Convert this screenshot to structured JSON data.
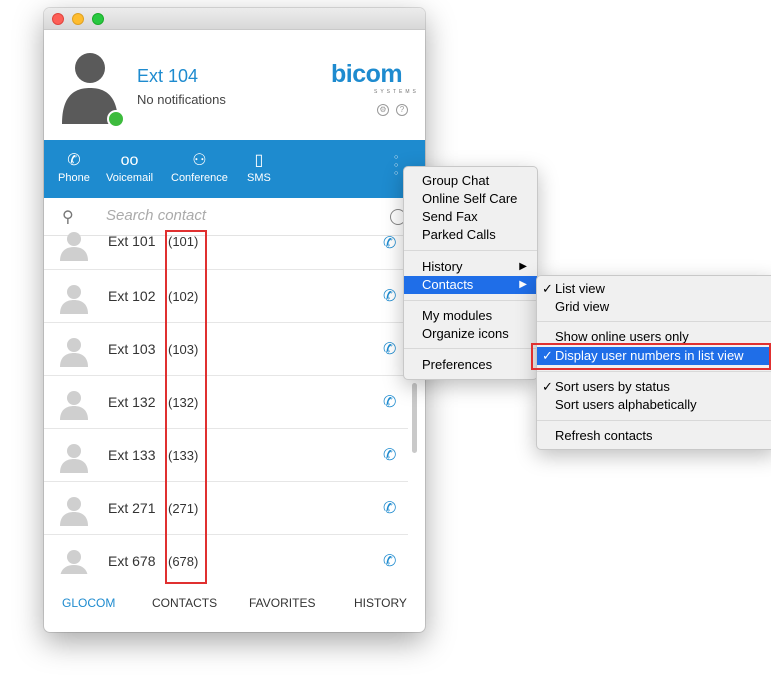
{
  "window": {
    "title": ""
  },
  "profile": {
    "name": "Ext 104",
    "status_text": "No notifications"
  },
  "brand": {
    "name": "bicom",
    "tagline": "SYSTEMS"
  },
  "header_icons": [
    "gear-icon",
    "help-icon"
  ],
  "toolbar": [
    {
      "label": "Phone",
      "icon": "phone-icon"
    },
    {
      "label": "Voicemail",
      "icon": "voicemail-icon"
    },
    {
      "label": "Conference",
      "icon": "conference-icon"
    },
    {
      "label": "SMS",
      "icon": "sms-icon"
    }
  ],
  "search": {
    "placeholder": "Search contact"
  },
  "contacts": [
    {
      "name": "Ext 101",
      "number": "(101)"
    },
    {
      "name": "Ext 102",
      "number": "(102)"
    },
    {
      "name": "Ext 103",
      "number": "(103)"
    },
    {
      "name": "Ext 132",
      "number": "(132)"
    },
    {
      "name": "Ext 133",
      "number": "(133)"
    },
    {
      "name": "Ext 271",
      "number": "(271)"
    },
    {
      "name": "Ext 678",
      "number": "(678)"
    }
  ],
  "bottom_nav": [
    {
      "label": "GLOCOM",
      "active": true
    },
    {
      "label": "CONTACTS",
      "active": false
    },
    {
      "label": "FAVORITES",
      "active": false
    },
    {
      "label": "HISTORY",
      "active": false
    }
  ],
  "menu": {
    "items": [
      "Group Chat",
      "Online Self Care",
      "Send Fax",
      "Parked Calls",
      "History",
      "Contacts",
      "My modules",
      "Organize icons",
      "Preferences"
    ],
    "selected": "Contacts"
  },
  "submenu": {
    "items": [
      {
        "label": "List view",
        "checked": true
      },
      {
        "label": "Grid view",
        "checked": false
      },
      {
        "label": "Show online users only",
        "checked": false
      },
      {
        "label": "Display user numbers in list view",
        "checked": true
      },
      {
        "label": "Sort users by status",
        "checked": true
      },
      {
        "label": "Sort users alphabetically",
        "checked": false
      },
      {
        "label": "Refresh contacts",
        "checked": false
      }
    ],
    "selected": "Display user numbers in list view"
  },
  "colors": {
    "accent": "#1e8bcf",
    "selection": "#1f6ee8",
    "highlight": "#e03030",
    "online": "#3dbb3d"
  }
}
